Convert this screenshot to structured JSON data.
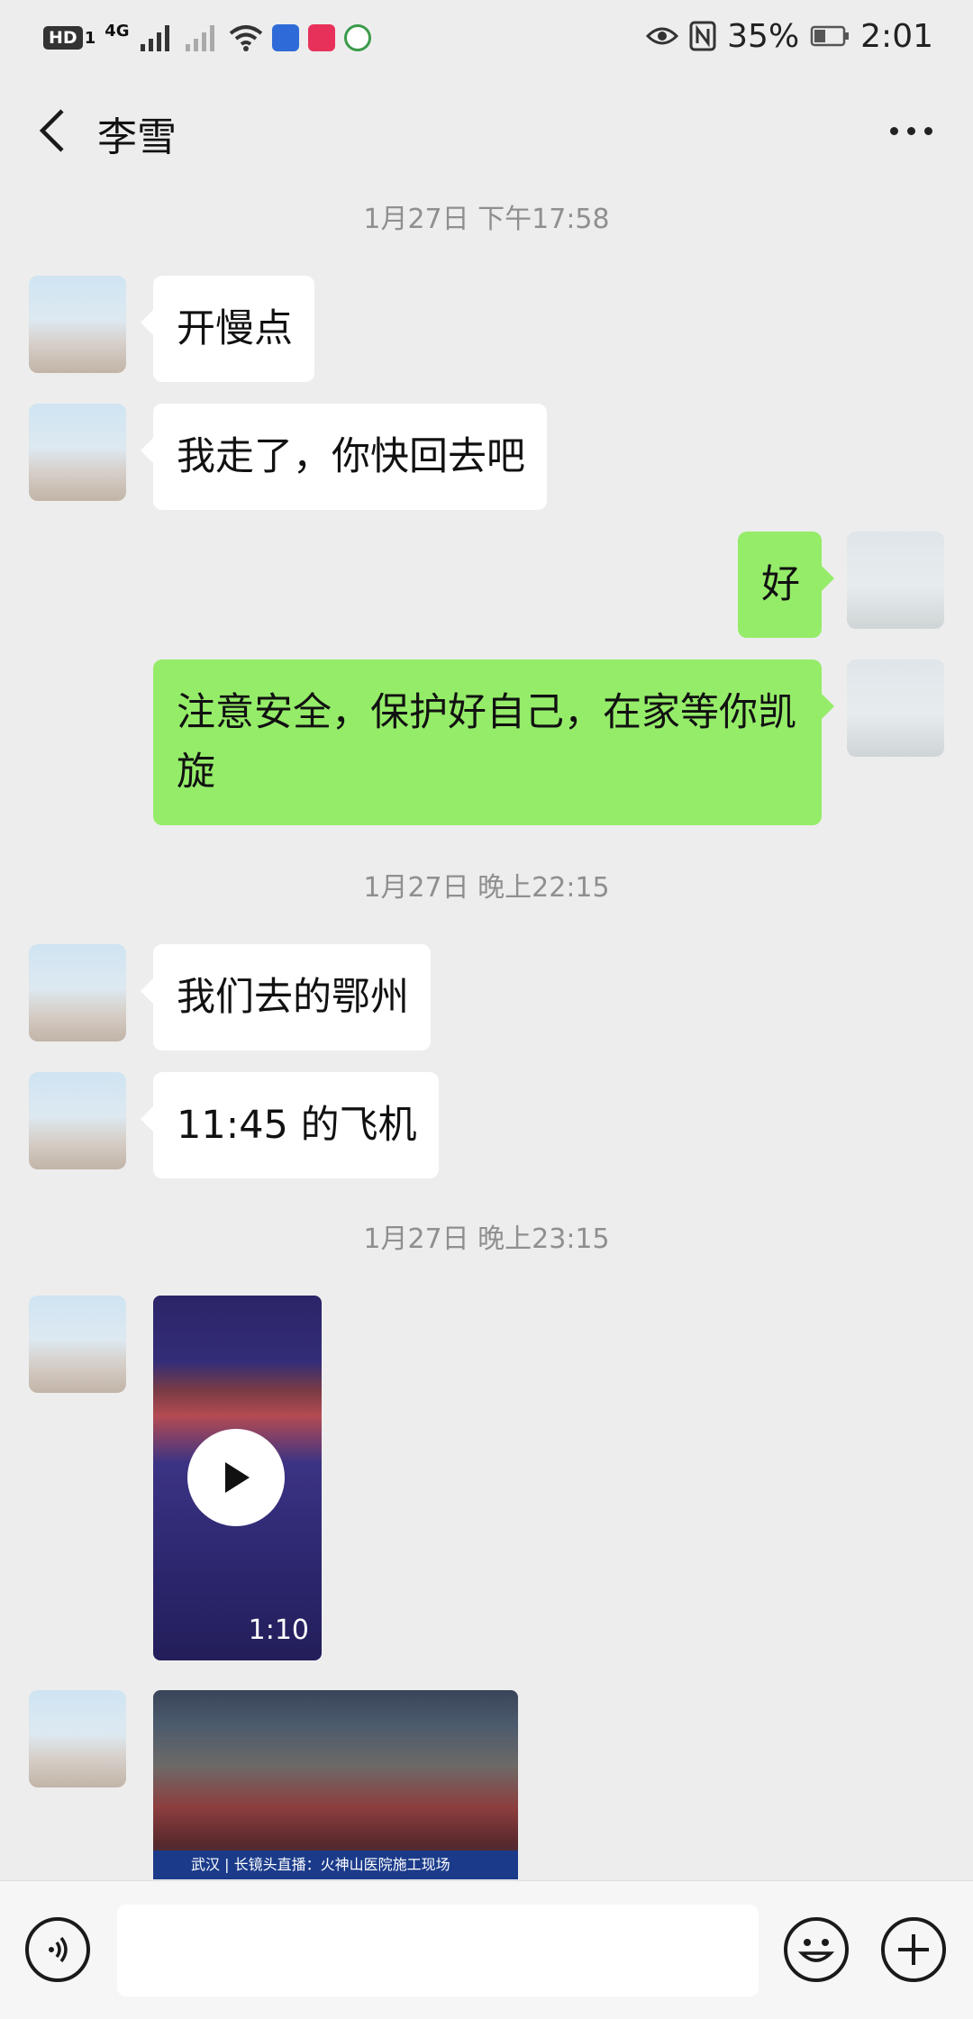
{
  "status_bar": {
    "hd_label": "HD",
    "sim_label": "1",
    "network_label": "4G",
    "battery_percent": "35%",
    "time": "2:01"
  },
  "header": {
    "title": "李雪"
  },
  "messages": [
    {
      "type": "timestamp",
      "text": "1月27日 下午17:58"
    },
    {
      "type": "text",
      "side": "in",
      "text": "开慢点"
    },
    {
      "type": "text",
      "side": "in",
      "text": "我走了，你快回去吧"
    },
    {
      "type": "text",
      "side": "out",
      "text": "好"
    },
    {
      "type": "text",
      "side": "out",
      "text": "注意安全，保护好自己，在家等你凯旋"
    },
    {
      "type": "timestamp",
      "text": "1月27日 晚上22:15"
    },
    {
      "type": "text",
      "side": "in",
      "text": "我们去的鄂州"
    },
    {
      "type": "text",
      "side": "in",
      "text": "11:45 的飞机"
    },
    {
      "type": "timestamp",
      "text": "1月27日 晚上23:15"
    },
    {
      "type": "video",
      "side": "in",
      "duration": "1:10"
    },
    {
      "type": "image",
      "side": "in",
      "caption": "武汉 | 长镜头直播：火神山医院施工现场"
    }
  ],
  "input_bar": {
    "placeholder": ""
  },
  "colors": {
    "background": "#ededed",
    "incoming_bubble": "#ffffff",
    "outgoing_bubble": "#95ec69"
  }
}
